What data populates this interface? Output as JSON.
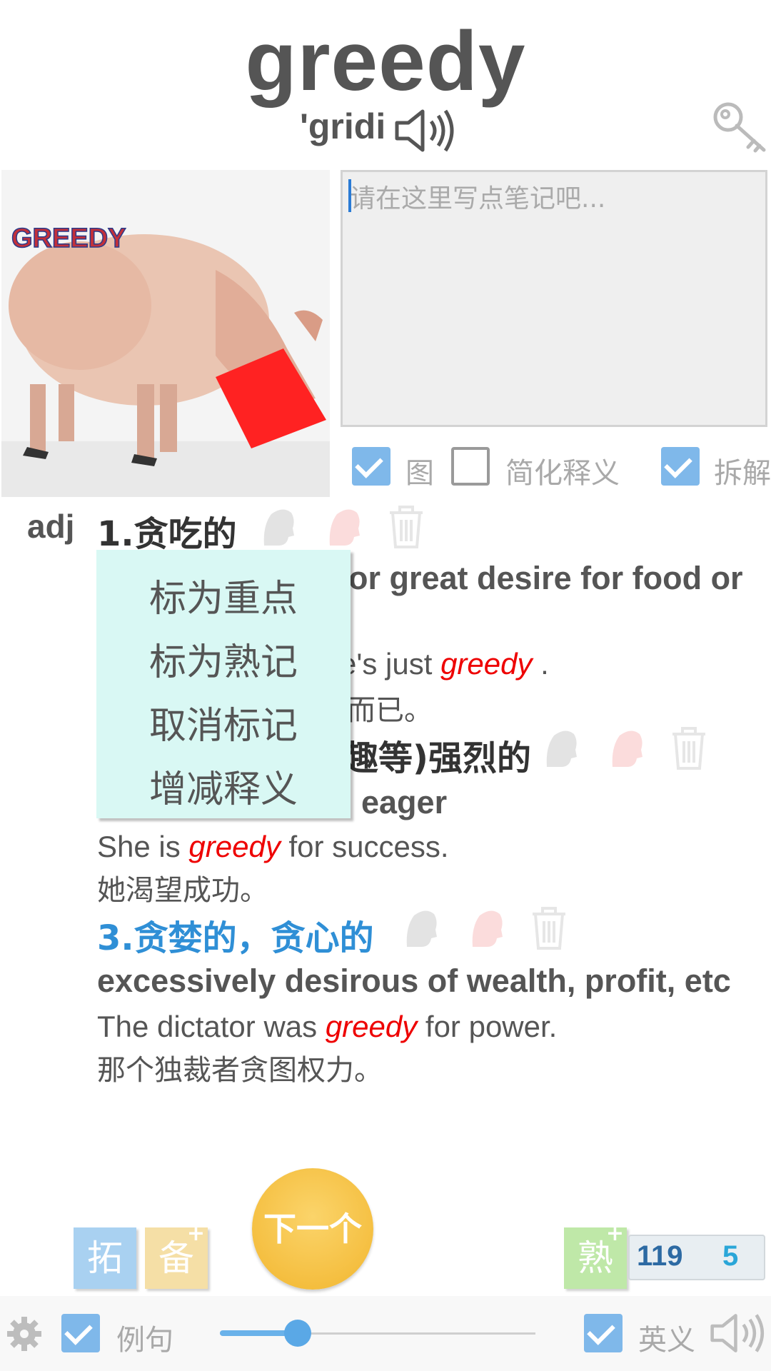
{
  "header": {
    "word": "greedy",
    "phonetic": "'gridi"
  },
  "notes": {
    "placeholder": "请在这里写点笔记吧..."
  },
  "options": {
    "image_label": "图",
    "simplify_label": "简化释义",
    "split_label": "拆解"
  },
  "part_of_speech": "adj",
  "definitions": [
    {
      "title": "1.贪吃的",
      "english": "or great desire for food or",
      "example_pre": "e's just ",
      "example_kw": "greedy",
      "example_post": " .",
      "translation": "而已。"
    },
    {
      "title": "趣等)强烈的",
      "english": "eager",
      "example_pre": "She is ",
      "example_kw": "greedy",
      "example_post": " for success.",
      "translation": "她渴望成功。"
    },
    {
      "title": "3.贪婪的，贪心的",
      "english": "excessively desirous of wealth, profit, etc",
      "example_pre": "The dictator was ",
      "example_kw": "greedy",
      "example_post": " for power.",
      "translation": "那个独裁者贪图权力。"
    }
  ],
  "context_menu": [
    "标为重点",
    "标为熟记",
    "取消标记",
    "增减释义"
  ],
  "bottom": {
    "expand_label": "拓",
    "backup_label": "备",
    "next_label": "下一个",
    "familiar_label": "熟",
    "count_total": "119",
    "count_done": "5",
    "example_label": "例句",
    "english_def_label": "英义",
    "slider_value": 0.2
  },
  "colors": {
    "accent_blue": "#2f8fd6",
    "keyword_red": "#e00000",
    "menu_bg": "#d9f8f4",
    "next_yellow": "#f2b62f"
  }
}
